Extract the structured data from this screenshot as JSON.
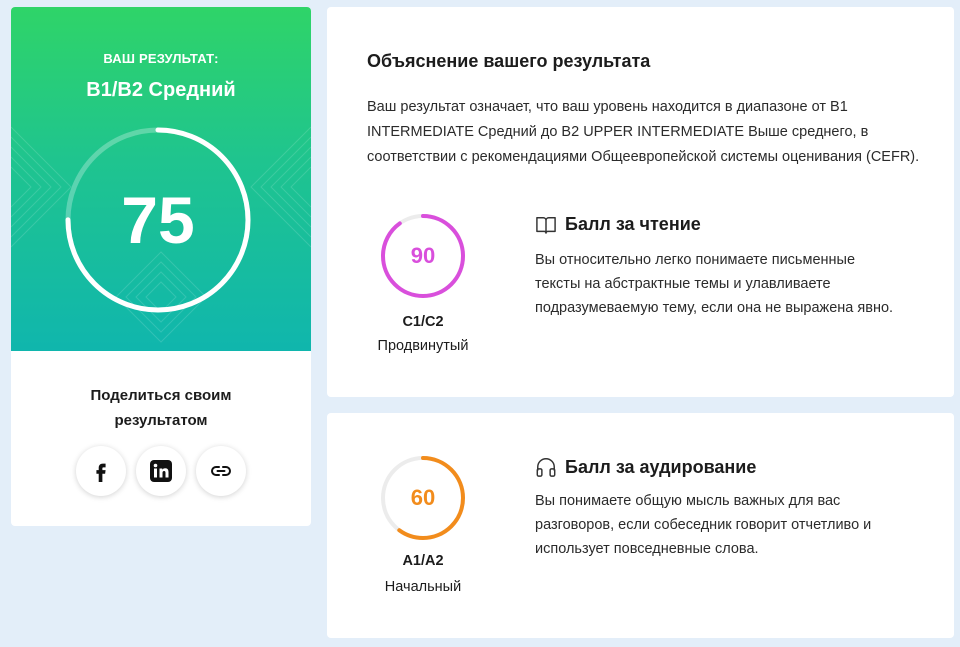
{
  "result": {
    "label": "ВАШ РЕЗУЛЬТАТ:",
    "level": "B1/B2 Средний",
    "score": "75",
    "score_fraction": 0.75,
    "share_title": "Поделиться своим результатом",
    "share_buttons": [
      {
        "name": "facebook",
        "icon": "facebook-icon"
      },
      {
        "name": "linkedin",
        "icon": "linkedin-icon"
      },
      {
        "name": "copy-link",
        "icon": "link-icon"
      }
    ]
  },
  "explanation": {
    "title": "Объяснение вашего результата",
    "text": "Ваш результат означает, что ваш уровень находится в диапазоне от B1 INTERMEDIATE Средний до B2 UPPER INTERMEDIATE Выше среднего, в соответствии с рекомендациями Общеевропейской системы оценивания (CEFR)."
  },
  "skills": {
    "reading": {
      "icon": "book-icon",
      "title": "Балл за чтение",
      "score": "90",
      "score_fraction": 0.9,
      "color": "#d94fdc",
      "level_code": "C1/C2",
      "level_name": "Продвинутый",
      "text": "Вы относительно легко понимаете письменные тексты на абстрактные темы и улавливаете подразумеваемую тему, если она не выражена явно."
    },
    "listening": {
      "icon": "headphones-icon",
      "title": "Балл за аудирование",
      "score": "60",
      "score_fraction": 0.6,
      "color": "#f28c1c",
      "level_code": "A1/A2",
      "level_name": "Начальный",
      "text": "Вы понимаете общую мысль важных для вас разговоров, если собеседник говорит отчетливо и использует повседневные слова."
    }
  },
  "colors": {
    "page_bg": "#e3eef9",
    "hero_top": "#2fd468",
    "hero_bottom": "#10b6ad",
    "ring_track": "#ececec"
  }
}
